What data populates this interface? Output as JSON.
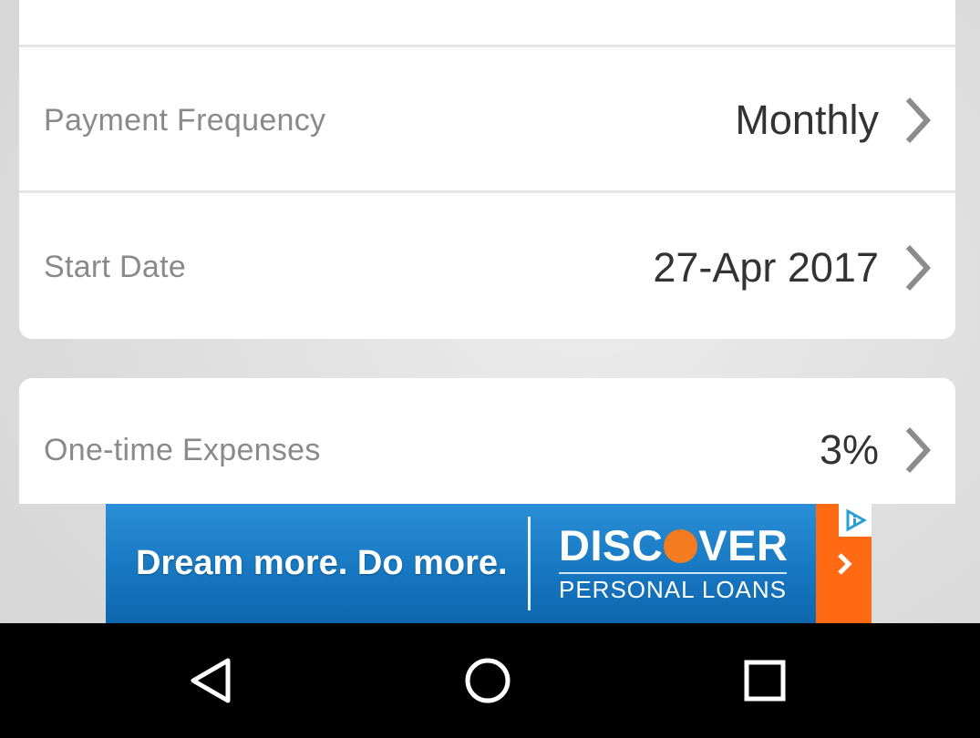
{
  "settings": {
    "rows": [
      {
        "label": "Payment Frequency",
        "value": "Monthly"
      },
      {
        "label": "Start Date",
        "value": "27-Apr 2017"
      },
      {
        "label": "One-time Expenses",
        "value": "3%"
      }
    ]
  },
  "ad": {
    "slogan": "Dream more. Do more.",
    "brand_left": "DISC",
    "brand_right": "VER",
    "brand_sub": "PERSONAL LOANS",
    "colors": {
      "blue": "#1778c2",
      "orange": "#ff6a13"
    },
    "icons": [
      "chevron-right-icon",
      "adchoices-icon"
    ]
  },
  "navbar": {
    "icons": [
      "back-icon",
      "home-icon",
      "recents-icon"
    ]
  },
  "colors": {
    "label": "#8a8a8a",
    "value": "#333333",
    "chevron": "#8c8c8c"
  }
}
